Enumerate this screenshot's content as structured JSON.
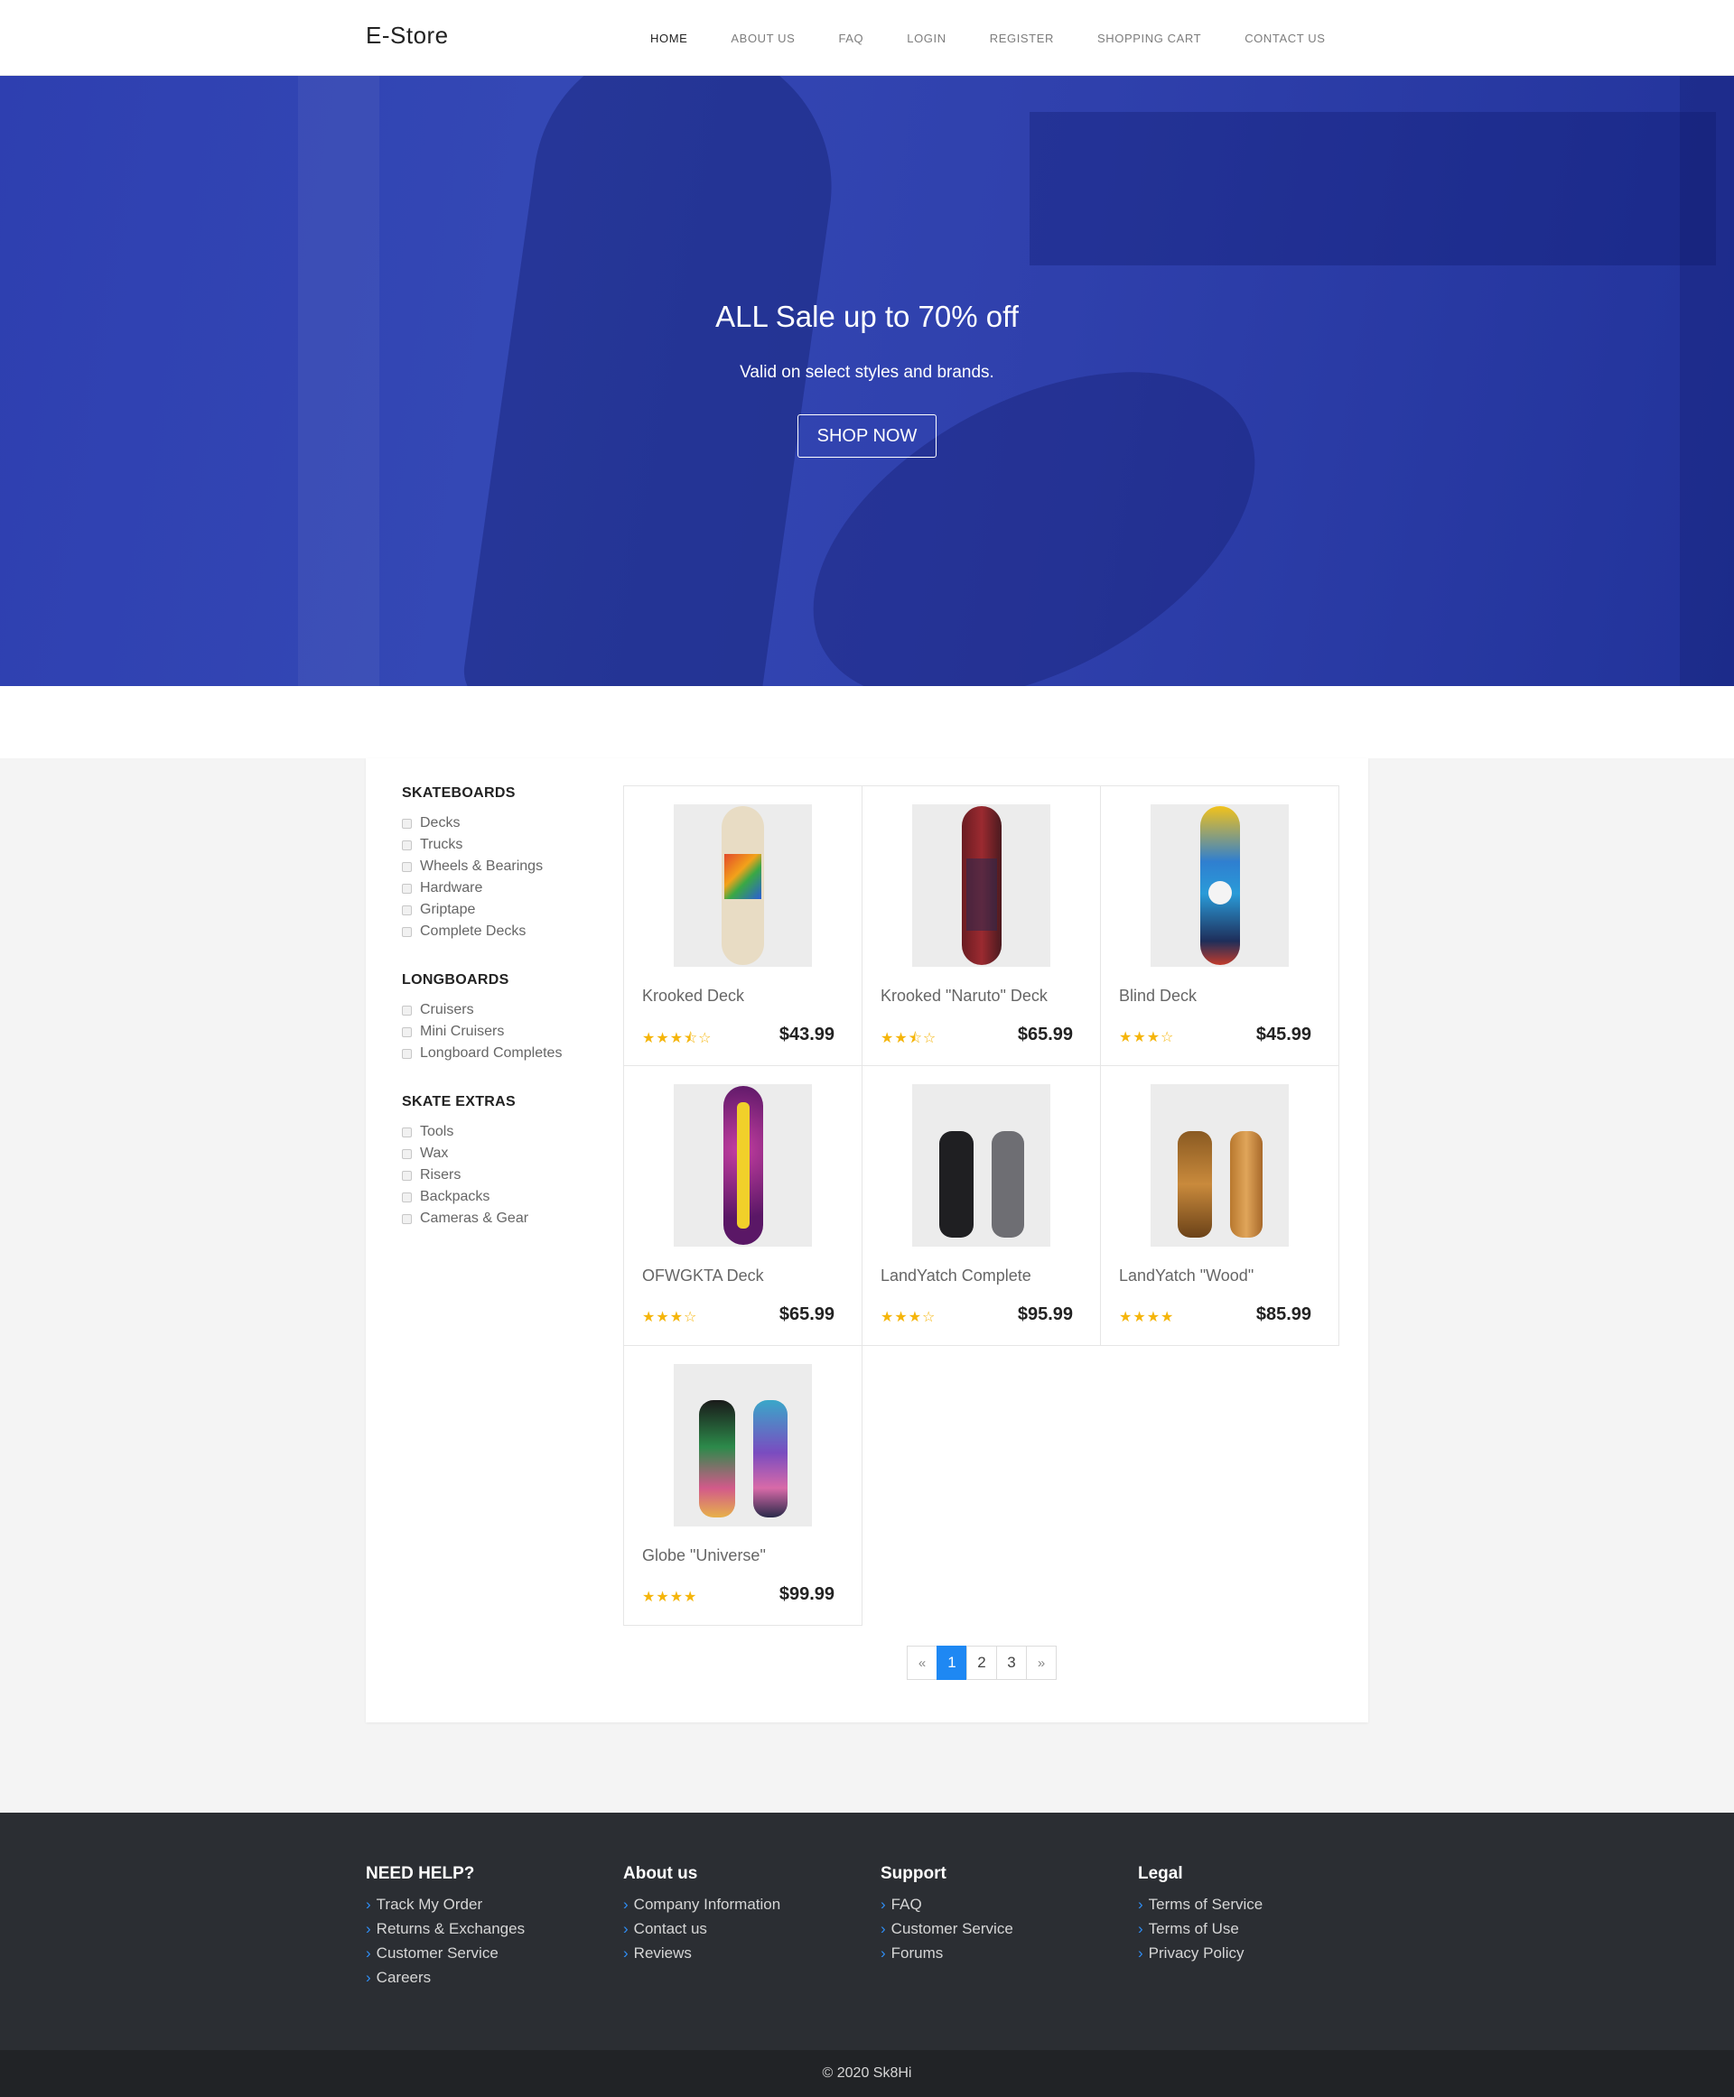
{
  "navbar": {
    "brand": "E-Store",
    "items": [
      "HOME",
      "ABOUT US",
      "FAQ",
      "LOGIN",
      "REGISTER",
      "SHOPPING CART",
      "CONTACT US"
    ],
    "active_index": 0
  },
  "hero": {
    "title": "ALL Sale up to 70% off",
    "subtitle": "Valid on select styles and brands.",
    "button": "SHOP NOW"
  },
  "sidebar": {
    "groups": [
      {
        "title": "SKATEBOARDS",
        "items": [
          "Decks",
          "Trucks",
          "Wheels & Bearings",
          "Hardware",
          "Griptape",
          "Complete Decks"
        ]
      },
      {
        "title": "LONGBOARDS",
        "items": [
          "Cruisers",
          "Mini Cruisers",
          "Longboard Completes"
        ]
      },
      {
        "title": "SKATE EXTRAS",
        "items": [
          "Tools",
          "Wax",
          "Risers",
          "Backpacks",
          "Cameras & Gear"
        ]
      }
    ]
  },
  "products": [
    {
      "name": "Krooked Deck",
      "price": "$43.99",
      "stars": "★★★⯪☆",
      "rating": 3.5
    },
    {
      "name": "Krooked \"Naruto\" Deck",
      "price": "$65.99",
      "stars": "★★⯪☆",
      "rating": 2.5
    },
    {
      "name": "Blind Deck",
      "price": "$45.99",
      "stars": "★★★☆",
      "rating": 3
    },
    {
      "name": "OFWGKTA Deck",
      "price": "$65.99",
      "stars": "★★★☆",
      "rating": 3
    },
    {
      "name": "LandYatch Complete",
      "price": "$95.99",
      "stars": "★★★☆",
      "rating": 3
    },
    {
      "name": "LandYatch \"Wood\"",
      "price": "$85.99",
      "stars": "★★★★",
      "rating": 4
    },
    {
      "name": "Globe \"Universe\"",
      "price": "$99.99",
      "stars": "★★★★",
      "rating": 4
    }
  ],
  "pagination": {
    "prev": "«",
    "pages": [
      "1",
      "2",
      "3"
    ],
    "next": "»",
    "current": "1"
  },
  "footer": {
    "columns": [
      {
        "title": "NEED HELP?",
        "links": [
          "Track My Order",
          "Returns & Exchanges",
          "Customer Service",
          "Careers"
        ]
      },
      {
        "title": "About us",
        "links": [
          "Company Information",
          "Contact us",
          "Reviews"
        ]
      },
      {
        "title": "Support",
        "links": [
          "FAQ",
          "Customer Service",
          "Forums"
        ]
      },
      {
        "title": "Legal",
        "links": [
          "Terms of Service",
          "Terms of Use",
          "Privacy Policy"
        ]
      }
    ],
    "chevron": "›",
    "copyright": "© 2020 Sk8Hi"
  },
  "colors": {
    "hero": "#3448b5",
    "accent": "#1e88f3",
    "star": "#f5b50a",
    "footer": "#2b2e33",
    "copyright_bar": "#212326"
  }
}
